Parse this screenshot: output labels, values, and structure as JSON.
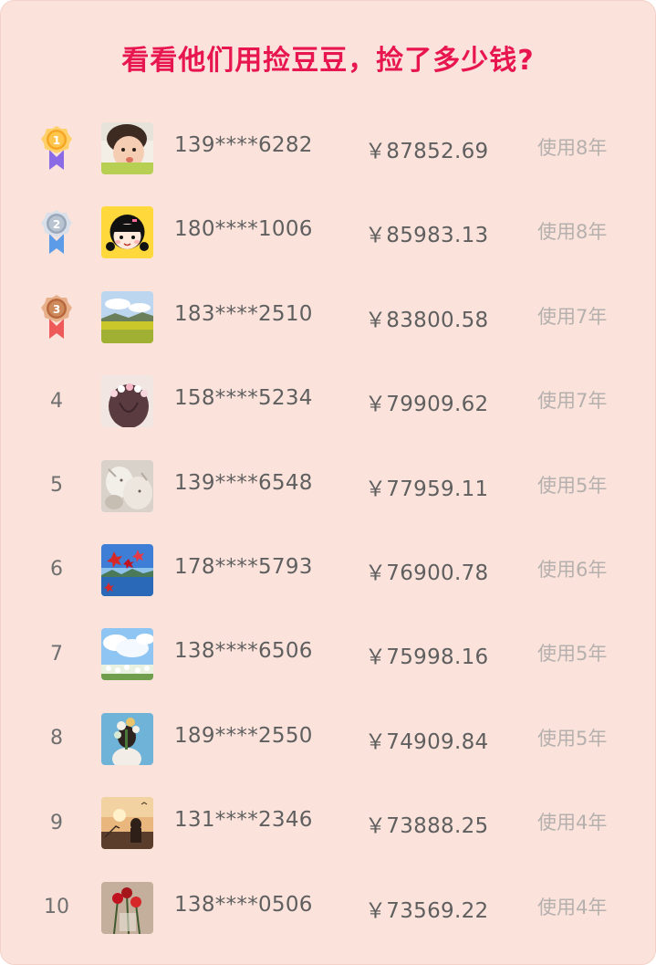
{
  "title": "看看他们用捡豆豆，捡了多少钱?",
  "colors": {
    "background": "#fbe3dc",
    "title": "#e8164f",
    "primary_text": "#5f5f5f",
    "muted_text": "#b5b0ad"
  },
  "rows": [
    {
      "rank": "1",
      "rank_icon": "gold-medal-icon",
      "avatar": "child-photo-avatar",
      "phone": "139****6282",
      "amount": "￥87852.69",
      "years": "使用8年"
    },
    {
      "rank": "2",
      "rank_icon": "silver-medal-icon",
      "avatar": "cartoon-girl-avatar",
      "phone": "180****1006",
      "amount": "￥85983.13",
      "years": "使用8年"
    },
    {
      "rank": "3",
      "rank_icon": "bronze-medal-icon",
      "avatar": "flower-field-avatar",
      "phone": "183****2510",
      "amount": "￥83800.58",
      "years": "使用7年"
    },
    {
      "rank": "4",
      "rank_icon": "",
      "avatar": "flower-crown-hair-avatar",
      "phone": "158****5234",
      "amount": "￥79909.62",
      "years": "使用7年"
    },
    {
      "rank": "5",
      "rank_icon": "",
      "avatar": "white-pets-avatar",
      "phone": "139****6548",
      "amount": "￥77959.11",
      "years": "使用5年"
    },
    {
      "rank": "6",
      "rank_icon": "",
      "avatar": "maple-lake-avatar",
      "phone": "178****5793",
      "amount": "￥76900.78",
      "years": "使用6年"
    },
    {
      "rank": "7",
      "rank_icon": "",
      "avatar": "sky-clouds-avatar",
      "phone": "138****6506",
      "amount": "￥75998.16",
      "years": "使用5年"
    },
    {
      "rank": "8",
      "rank_icon": "",
      "avatar": "flower-bouquet-avatar",
      "phone": "189****2550",
      "amount": "￥74909.84",
      "years": "使用5年"
    },
    {
      "rank": "9",
      "rank_icon": "",
      "avatar": "sunset-silhouette-avatar",
      "phone": "131****2346",
      "amount": "￥73888.25",
      "years": "使用4年"
    },
    {
      "rank": "10",
      "rank_icon": "",
      "avatar": "red-roses-avatar",
      "phone": "138****0506",
      "amount": "￥73569.22",
      "years": "使用4年"
    }
  ]
}
